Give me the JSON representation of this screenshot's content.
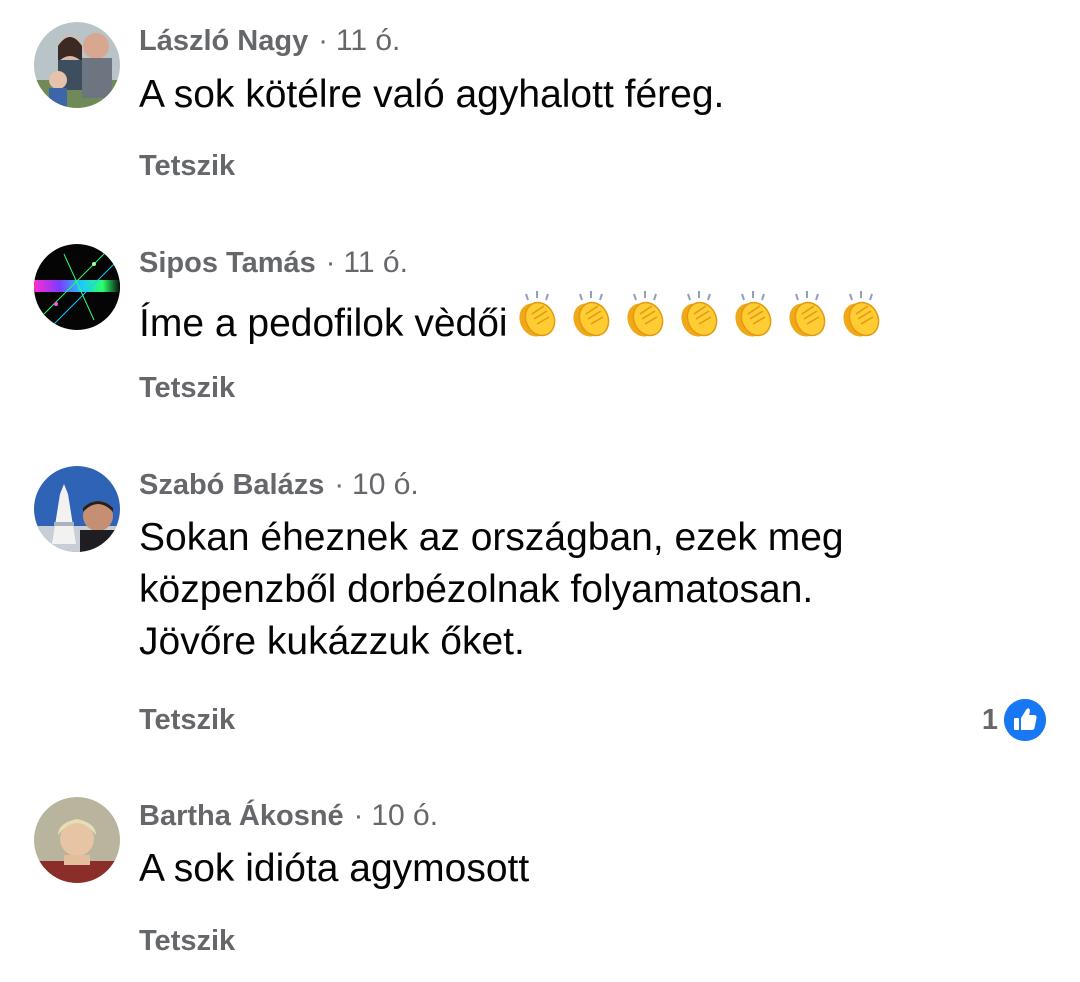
{
  "comments": [
    {
      "author": "László Nagy",
      "separator": "·",
      "time": "11 ó.",
      "text_lines": [
        "A sok kötélre való agyhalott féreg."
      ],
      "like_label": "Tetszik",
      "avatar_icon": "profile-photo-family"
    },
    {
      "author": "Sipos Tamás",
      "separator": "·",
      "time": "11 ó.",
      "text_lines": [
        "Íme a pedofilok vèdői"
      ],
      "emoji": "clapping-hands",
      "emoji_count": 7,
      "like_label": "Tetszik",
      "avatar_icon": "profile-photo-abstract-light"
    },
    {
      "author": "Szabó Balázs",
      "separator": "·",
      "time": "10 ó.",
      "text_lines": [
        "Sokan éheznek az országban, ezek meg",
        "közpenzből dorbézolnak folyamatosan.",
        "Jövőre kukázzuk őket."
      ],
      "like_label": "Tetszik",
      "reaction_count": "1",
      "reaction_icon": "like-thumb-icon",
      "avatar_icon": "profile-photo-monument"
    },
    {
      "author": "Bartha Ákosné",
      "separator": "·",
      "time": "10 ó.",
      "text_lines": [
        "A sok idióta agymosott"
      ],
      "like_label": "Tetszik",
      "avatar_icon": "profile-photo-woman"
    }
  ],
  "colors": {
    "secondary_text": "#65676b",
    "primary_text": "#050505",
    "like_blue": "#1877f2",
    "emoji_yellow": "#ffcc33"
  }
}
